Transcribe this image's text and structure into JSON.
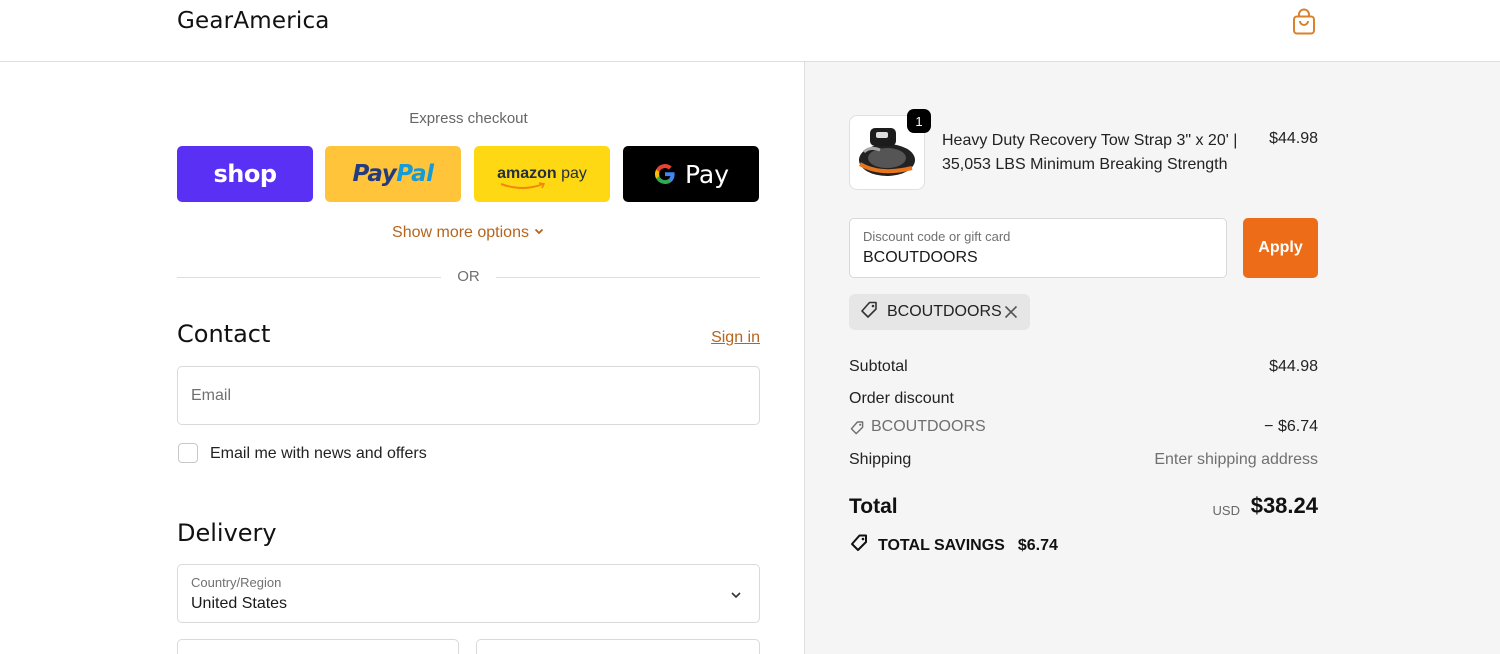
{
  "header": {
    "brand": "GearAmerica",
    "cart_icon": "shopping-bag-icon"
  },
  "express": {
    "title": "Express checkout",
    "buttons": [
      {
        "name": "shop-pay",
        "label": "shop",
        "color": "#5a31f4"
      },
      {
        "name": "paypal",
        "label_a": "Pay",
        "label_b": "Pal",
        "color": "#ffc439"
      },
      {
        "name": "amazon-pay",
        "label_a": "amazon",
        "label_b": "pay",
        "color": "#ffd814"
      },
      {
        "name": "google-pay",
        "label": "Pay",
        "color": "#000000"
      }
    ],
    "more_options": "Show more options",
    "or_text": "OR"
  },
  "contact": {
    "title": "Contact",
    "sign_in": "Sign in",
    "email_placeholder": "Email",
    "newsletter_label": "Email me with news and offers",
    "newsletter_checked": false
  },
  "delivery": {
    "title": "Delivery",
    "country_label": "Country/Region",
    "country_value": "United States"
  },
  "summary": {
    "product": {
      "quantity": "1",
      "name": "Heavy Duty Recovery Tow Strap 3\" x 20' | 35,053 LBS Minimum Breaking Strength",
      "price": "$44.98"
    },
    "discount": {
      "label": "Discount code or gift card",
      "value": "BCOUTDOORS",
      "apply_label": "Apply",
      "applied_code": "BCOUTDOORS"
    },
    "subtotal_label": "Subtotal",
    "subtotal_value": "$44.98",
    "order_discount_label": "Order discount",
    "discount_code": "BCOUTDOORS",
    "discount_amount": "− $6.74",
    "shipping_label": "Shipping",
    "shipping_value": "Enter shipping address",
    "total_label": "Total",
    "currency": "USD",
    "total_value": "$38.24",
    "savings_label": "TOTAL SAVINGS",
    "savings_value": "$6.74"
  },
  "colors": {
    "accent": "#ec6c17",
    "link": "#b5651d",
    "summary_bg": "#f5f5f5"
  }
}
